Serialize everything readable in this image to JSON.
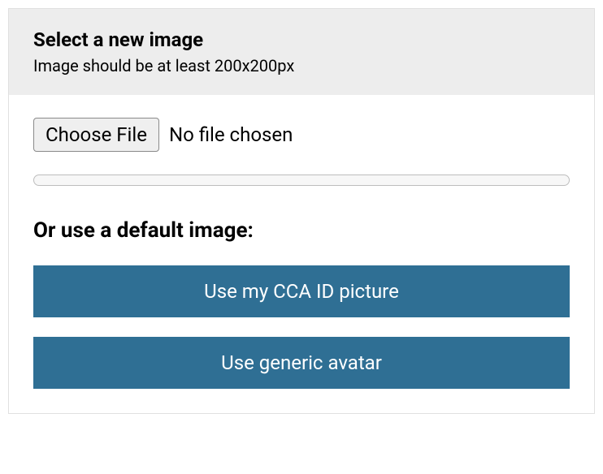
{
  "header": {
    "title": "Select a new image",
    "subtitle": "Image should be at least 200x200px"
  },
  "file_picker": {
    "button_label": "Choose File",
    "status_text": "No file chosen"
  },
  "default_section": {
    "heading": "Or use a default image:",
    "buttons": {
      "cca_id": "Use my CCA ID picture",
      "generic": "Use generic avatar"
    }
  }
}
